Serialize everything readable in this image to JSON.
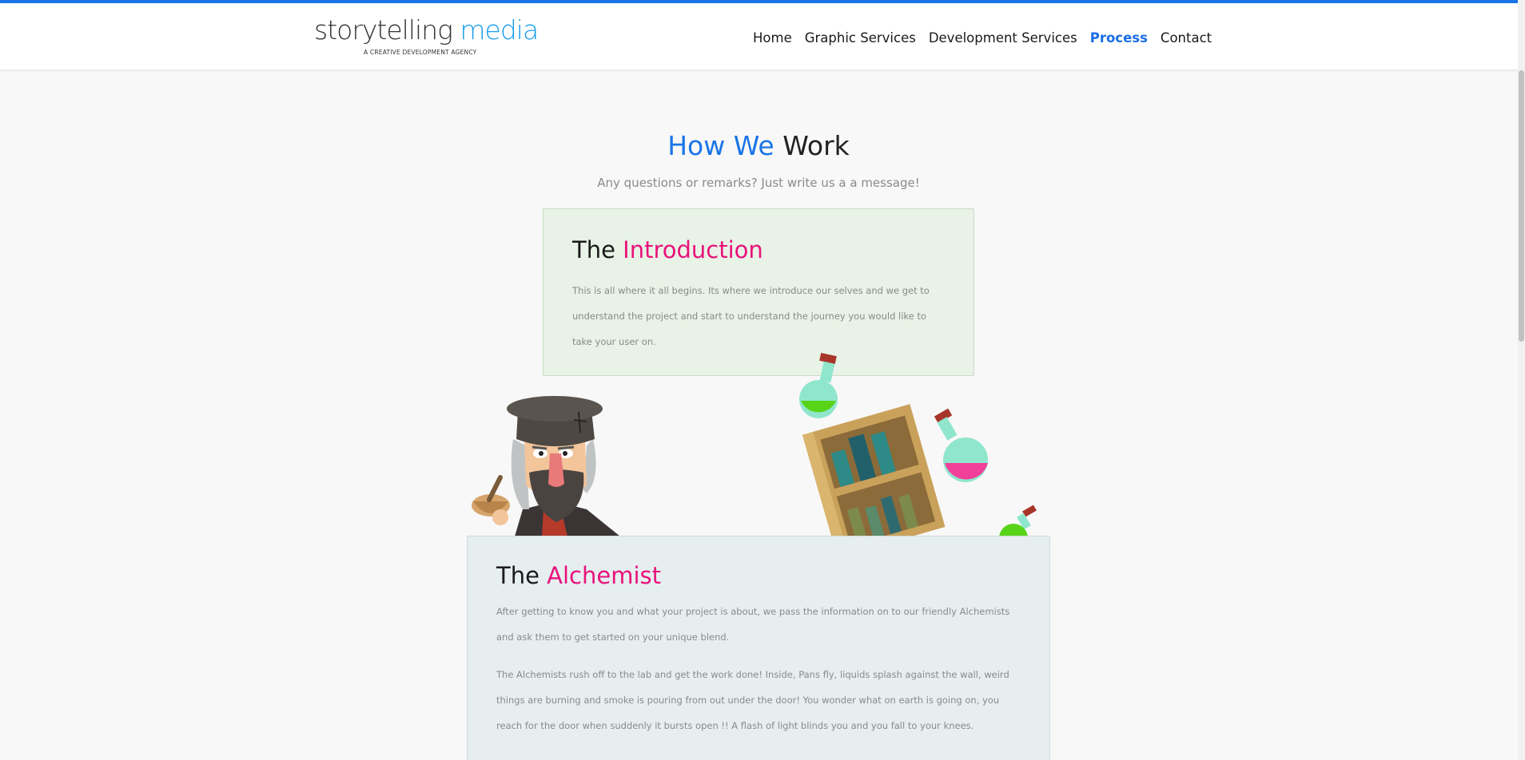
{
  "header": {
    "logo_text": "storytelling",
    "logo_accent": "media",
    "logo_tagline": "A CREATIVE DEVELOPMENT AGENCY",
    "nav": [
      {
        "label": "Home",
        "active": false
      },
      {
        "label": "Graphic Services",
        "active": false
      },
      {
        "label": "Development Services",
        "active": false
      },
      {
        "label": "Process",
        "active": true
      },
      {
        "label": "Contact",
        "active": false
      }
    ]
  },
  "hero": {
    "title_accent": "How We",
    "title_rest": "Work",
    "subtitle": "Any questions or remarks? Just write us a a message!"
  },
  "intro_card": {
    "title_prefix": "The",
    "title_accent": "Introduction",
    "text": "This is all where it all begins. Its where we introduce our selves and we get to understand the project and start to understand the journey you would like to take your user on."
  },
  "alchemist_card": {
    "title_prefix": "The",
    "title_accent": "Alchemist",
    "paragraphs": [
      "After getting to know you and what your project is about, we pass the information on to our friendly Alchemists and ask them to get started on your unique blend.",
      "The Alchemists rush off to the lab and get the work done! Inside, Pans fly, liquids splash against the wall, weird things are burning and smoke is pouring from out under the door! You wonder what on earth is going on, you reach for the door when suddenly it bursts open !! A flash of light blinds you and you fall to your knees."
    ]
  },
  "colors": {
    "accent_blue": "#1a75e8",
    "accent_pink": "#e8137b",
    "intro_bg": "#e8f2e6",
    "alchemist_bg": "#e7eef0"
  },
  "icons": {
    "illustration_1": "alchemist-character",
    "illustration_2": "potion-crate",
    "illustration_3": "potion-flask"
  }
}
